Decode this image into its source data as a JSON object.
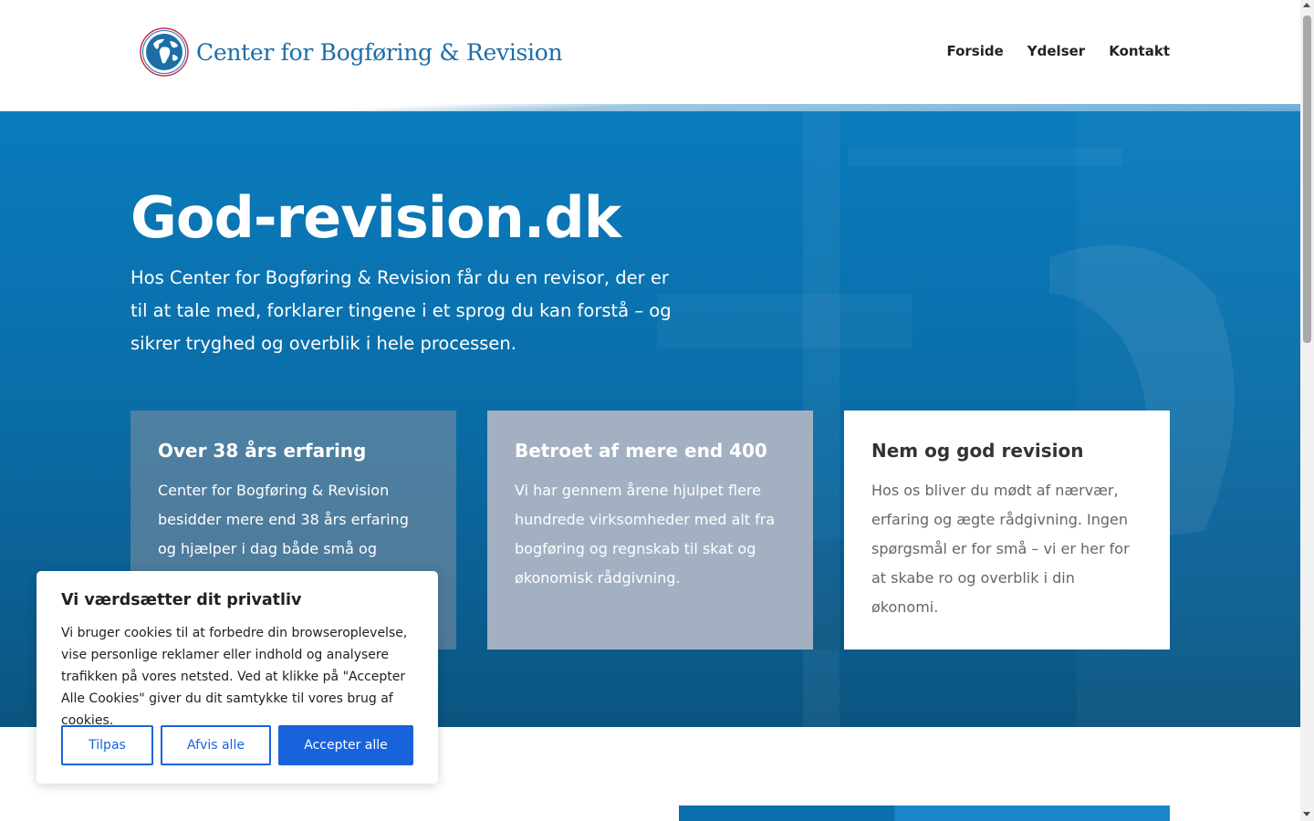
{
  "header": {
    "logo_text": "Center for Bogføring & Revision",
    "nav": [
      "Forside",
      "Ydelser",
      "Kontakt"
    ]
  },
  "hero": {
    "title": "God-revision.dk",
    "text": "Hos Center for Bogføring & Revision får du en revisor, der er til at tale med, forklarer tingene i et sprog du kan forstå – og sikrer tryghed og overblik i hele processen."
  },
  "cards": [
    {
      "title": "Over 38 års erfaring",
      "text": "Center for Bogføring & Revision besidder mere end 38 års erfaring og hjælper i dag både små og"
    },
    {
      "title": "Betroet af mere end 400",
      "text": "Vi har gennem årene hjulpet flere hundrede virksomheder med alt fra bogføring og regnskab til skat og økonomisk rådgivning."
    },
    {
      "title": "Nem og god revision",
      "text": "Hos os bliver du mødt af nærvær, erfaring og ægte rådgivning. Ingen spørgsmål er for små – vi er her for at skabe ro og overblik i din økonomi."
    }
  ],
  "cookie": {
    "title": "Vi værdsætter dit privatliv",
    "text": "Vi bruger cookies til at forbedre din browseroplevelse, vise personlige reklamer eller indhold og analysere trafikken på vores netsted. Ved at klikke på \"Accepter Alle Cookies\" giver du dit samtykke til vores brug af cookies.",
    "btn_customize": "Tilpas",
    "btn_reject": "Afvis alle",
    "btn_accept": "Accepter alle"
  },
  "colors": {
    "brand_blue": "#1d6ea8",
    "hero_blue": "#0a6ea9",
    "accept_button": "#1863dc"
  },
  "icons": [
    "globe-logo-icon",
    "scroll-up-icon",
    "scroll-down-icon"
  ]
}
